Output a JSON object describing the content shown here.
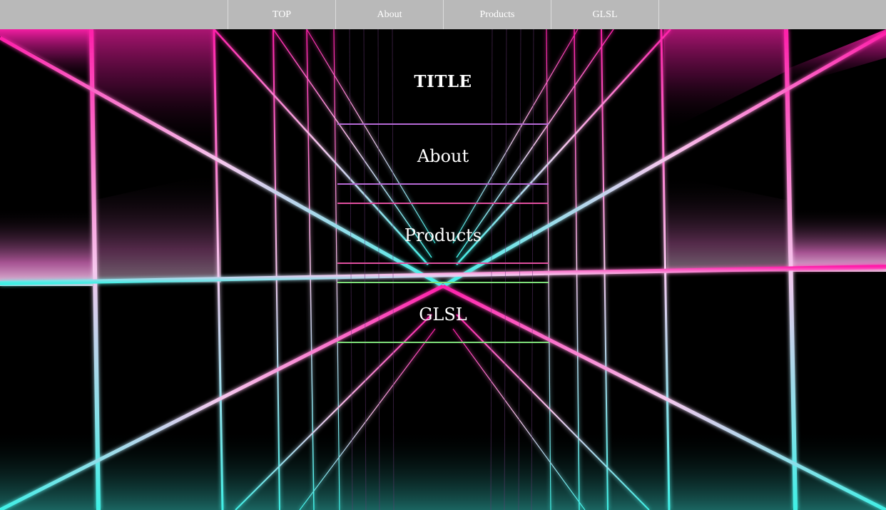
{
  "nav": {
    "items": [
      {
        "label": "TOP"
      },
      {
        "label": "About"
      },
      {
        "label": "Products"
      },
      {
        "label": "GLSL"
      }
    ]
  },
  "hero": {
    "title": "TITLE"
  },
  "sections": [
    {
      "label": "About",
      "color": "#b66ad6"
    },
    {
      "label": "Products",
      "color": "#e04f9f"
    },
    {
      "label": "GLSL",
      "color": "#7fe07a"
    }
  ],
  "background": {
    "description_colors": {
      "top": "#ff1faa",
      "bottom": "#3ff0e6",
      "base": "#000000"
    }
  }
}
